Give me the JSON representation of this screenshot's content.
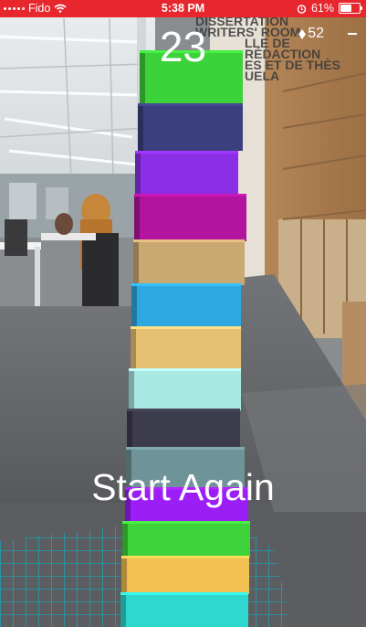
{
  "status_bar": {
    "carrier": "Fido",
    "time": "5:38 PM",
    "battery_percent": "61%",
    "battery_level": 0.61
  },
  "hud": {
    "score": "23",
    "gems": "52"
  },
  "start_again_label": "Start Again",
  "background_sign": [
    "DISSERTATION",
    "WRITERS' ROOM",
    "LLE DE RÉDACTION",
    "ES ET DE THÈS",
    "UELA"
  ],
  "tower": {
    "block_colors_top_to_bottom": [
      "#3cd23a",
      "#3c3f7e",
      "#8b2fe6",
      "#b2139f",
      "#c9a871",
      "#2ea8e0",
      "#e6c174",
      "#a9e7e2",
      "#3d3c4d",
      "#6e9499",
      "#9a1ef5",
      "#3fd23a",
      "#f0c050",
      "#2fd8cf"
    ]
  },
  "colors": {
    "status_bar": "#e7262e",
    "floor_grid": "#16a6b8"
  }
}
